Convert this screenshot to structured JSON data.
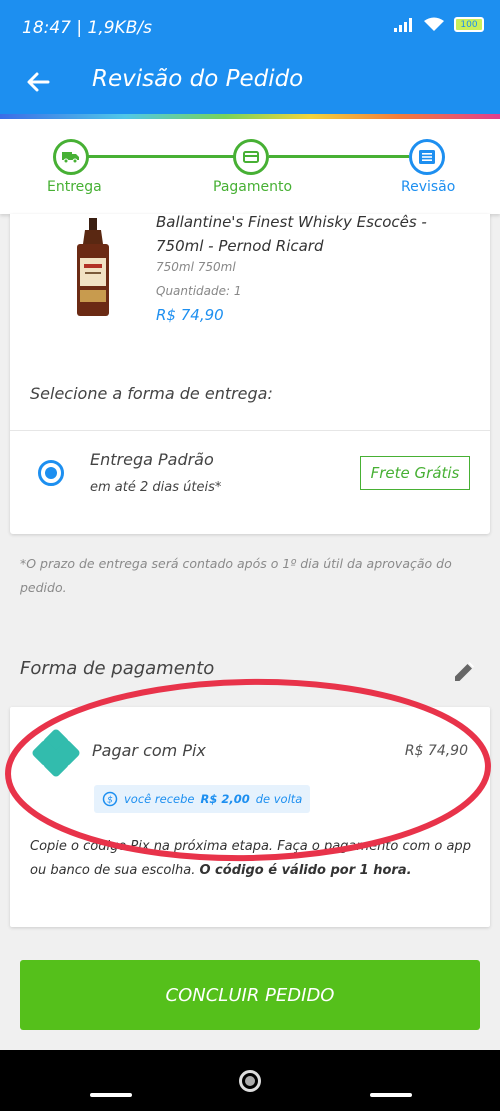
{
  "status_bar": {
    "time": "18:47 | 1,9KB/s",
    "battery": "100"
  },
  "header": {
    "title": "Revisão do Pedido"
  },
  "stepper": {
    "steps": [
      {
        "label": "Entrega",
        "icon": "truck-icon"
      },
      {
        "label": "Pagamento",
        "icon": "card-icon"
      },
      {
        "label": "Revisão",
        "icon": "document-icon"
      }
    ],
    "active_index": 2
  },
  "product": {
    "name": "Ballantine's Finest Whisky Escocês - 750ml - Pernod Ricard",
    "volume": "750ml 750ml",
    "quantity": "Quantidade: 1",
    "price": "R$ 74,90"
  },
  "delivery": {
    "prompt": "Selecione a forma de entrega:",
    "option_name": "Entrega Padrão",
    "option_time": "em até 2 dias úteis*",
    "freight_badge": "Frete Grátis",
    "note": "*O prazo de entrega será contado após o 1º dia útil da aprovação do pedido."
  },
  "payment": {
    "heading": "Forma de pagamento",
    "method": "Pagar com Pix",
    "price": "R$ 74,90",
    "cashback_prefix": "você recebe",
    "cashback_value": "R$ 2,00",
    "cashback_suffix": "de volta",
    "instructions": "Copie o código Pix na próxima etapa. Faça o pagamento com o app ou banco de sua escolha.",
    "instructions_bold": "O código é válido por 1 hora."
  },
  "actions": {
    "conclude": "CONCLUIR PEDIDO"
  },
  "colors": {
    "primary": "#1d8ff0",
    "success": "#47b034",
    "button": "#55c01b",
    "annotation": "#e8334a"
  }
}
